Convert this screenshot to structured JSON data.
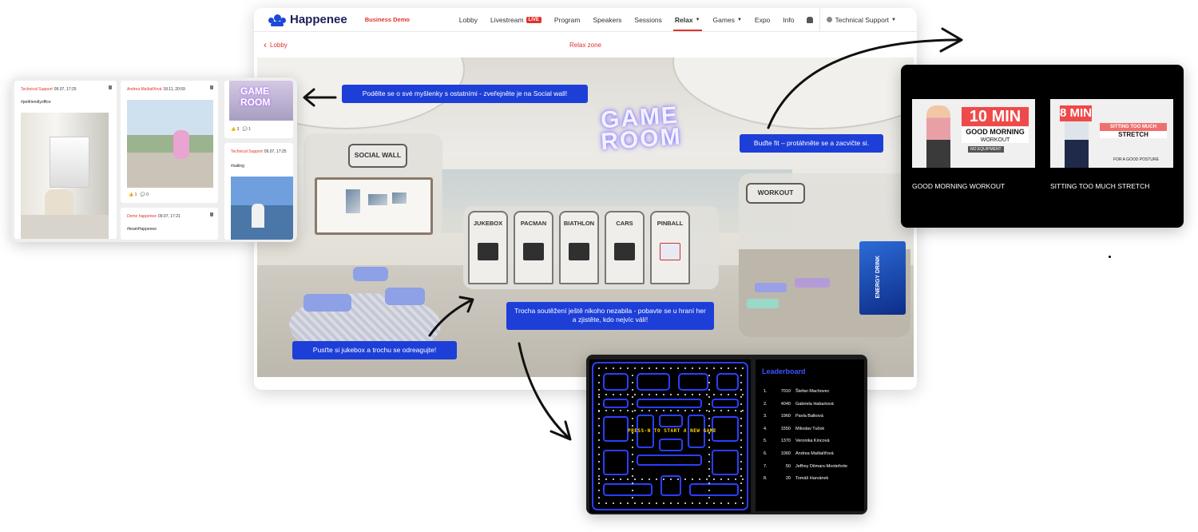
{
  "app": {
    "brand": "Happenee",
    "event_tag": "Business Demo",
    "nav": [
      {
        "label": "Lobby"
      },
      {
        "label": "Livestream",
        "badge": "LIVE"
      },
      {
        "label": "Program"
      },
      {
        "label": "Speakers"
      },
      {
        "label": "Sessions"
      },
      {
        "label": "Relax",
        "dropdown": true,
        "active": true
      },
      {
        "label": "Games",
        "dropdown": true
      },
      {
        "label": "Expo"
      },
      {
        "label": "Info"
      }
    ],
    "user_menu": "Technical Support",
    "back_label": "Lobby",
    "zone_title": "Relax zone"
  },
  "scene": {
    "social_wall_sign": "SOCIAL WALL",
    "workout_sign": "WORKOUT",
    "neon_sign": "GAME ROOM",
    "machines": [
      "JUKEBOX",
      "PACMAN",
      "BIATHLON",
      "CARS",
      "PINBALL"
    ],
    "vending_text": "ENERGY DRINK"
  },
  "callouts": {
    "social": "Podělte se o své myšlenky s ostatními - zveřejněte je na Social wall!",
    "fit": "Buďte fit – protáhněte se a zacvičte si.",
    "games": "Trocha soutěžení ještě nikoho nezabila - pobavte se u hraní her a zjistěte, kdo nejvíc válí!",
    "jukebox": "Pusťte si jukebox a trochu se odreagujte!"
  },
  "social_wall": {
    "posts": [
      {
        "author": "Technical Support",
        "time": "09.07, 17:25",
        "tag": "#petfriendlyoffice"
      },
      {
        "author": "Andrea Maštalířová",
        "time": "18.11, 20:59",
        "likes": "1",
        "comments": "0"
      },
      {
        "author": "Technical Support",
        "time": "09.07, 17:25",
        "tag": "#sailing"
      },
      {
        "author": "Demo happenee",
        "time": "09.07, 17:21",
        "tag": "#teamHappenee"
      },
      {
        "likes": "3",
        "comments": "1"
      }
    ]
  },
  "videos": [
    {
      "thumb_big": "10 MIN",
      "thumb_line1": "GOOD MORNING",
      "thumb_line2": "WORKOUT",
      "thumb_note": "NO EQUIPMENT",
      "title": "GOOD MORNING WORKOUT"
    },
    {
      "thumb_big": "8 MIN",
      "thumb_line1": "SITTING TOO MUCH",
      "thumb_line2": "STRETCH",
      "thumb_note": "FOR A GOOD POSTURE",
      "title": "SITTING TOO MUCH STRETCH"
    }
  ],
  "game": {
    "press_message": "PRESS-N TO START A NEW GAME",
    "leaderboard_title": "Leaderboard",
    "leaderboard": [
      {
        "rank": "1.",
        "score": "7010",
        "name": "Štefan Machovec"
      },
      {
        "rank": "2.",
        "score": "4040",
        "name": "Gabriela Habartová"
      },
      {
        "rank": "3.",
        "score": "1960",
        "name": "Pavla Balková"
      },
      {
        "rank": "4.",
        "score": "1550",
        "name": "Miloslav Tuček"
      },
      {
        "rank": "5.",
        "score": "1370",
        "name": "Veronika Kincová"
      },
      {
        "rank": "6.",
        "score": "1060",
        "name": "Andrea Maštalířová"
      },
      {
        "rank": "7.",
        "score": "50",
        "name": "Jeffrey Ditmars-Monteforte"
      },
      {
        "rank": "8.",
        "score": "20",
        "name": "Tomáš Harvánek"
      }
    ]
  },
  "colors": {
    "accent_red": "#e0322d",
    "callout_blue": "#1d3fd8",
    "brand_navy": "#1d1f5b",
    "leaderboard_blue": "#3a56ff",
    "maze_blue": "#2a3fff"
  },
  "icons": [
    "happenee-logo-icon",
    "bell-icon",
    "user-icon",
    "chevron-left-icon",
    "trash-icon",
    "like-icon",
    "comment-icon"
  ]
}
